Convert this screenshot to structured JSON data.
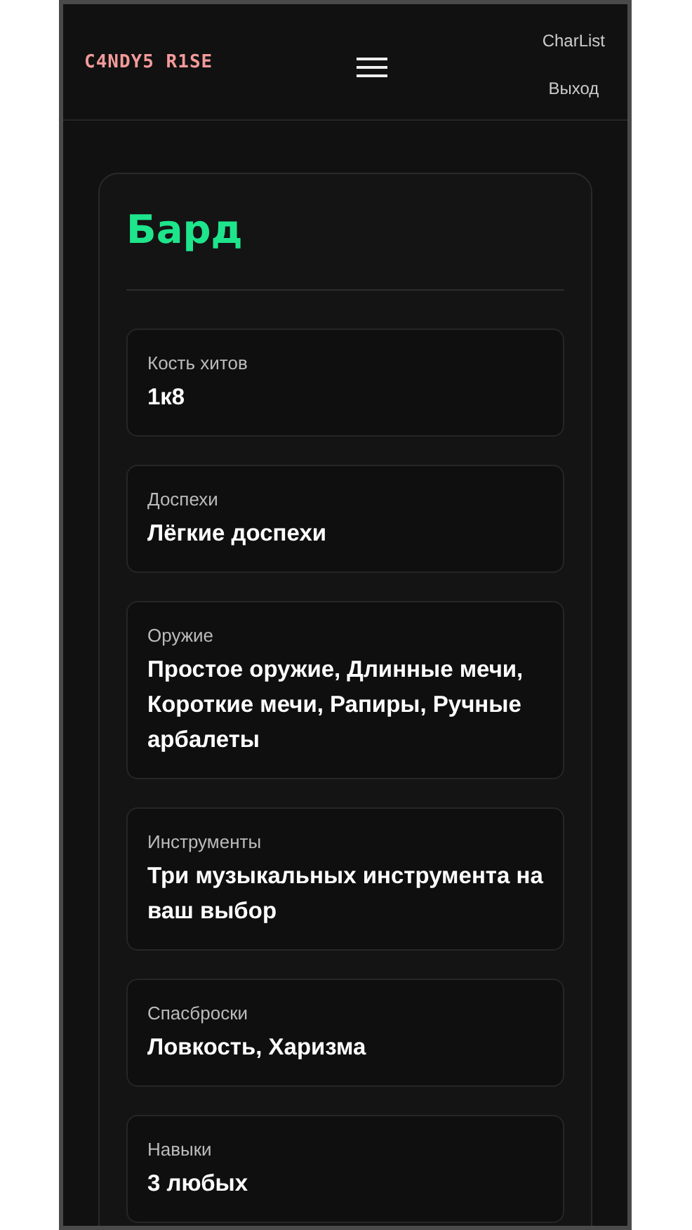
{
  "header": {
    "logo": "C4NDY5 R1SE",
    "links": [
      "CharList",
      "Выход"
    ]
  },
  "card": {
    "title": "Бард",
    "items": [
      {
        "label": "Кость хитов",
        "value": "1к8"
      },
      {
        "label": "Доспехи",
        "value": "Лёгкие доспехи"
      },
      {
        "label": "Оружие",
        "value": "Простое оружие, Длинные мечи, Короткие мечи, Рапиры, Ручные арбалеты"
      },
      {
        "label": "Инструменты",
        "value": "Три музыкальных инструмента на ваш выбор"
      },
      {
        "label": "Спасброски",
        "value": "Ловкость, Харизма"
      },
      {
        "label": "Навыки",
        "value": "3 любых"
      }
    ]
  }
}
